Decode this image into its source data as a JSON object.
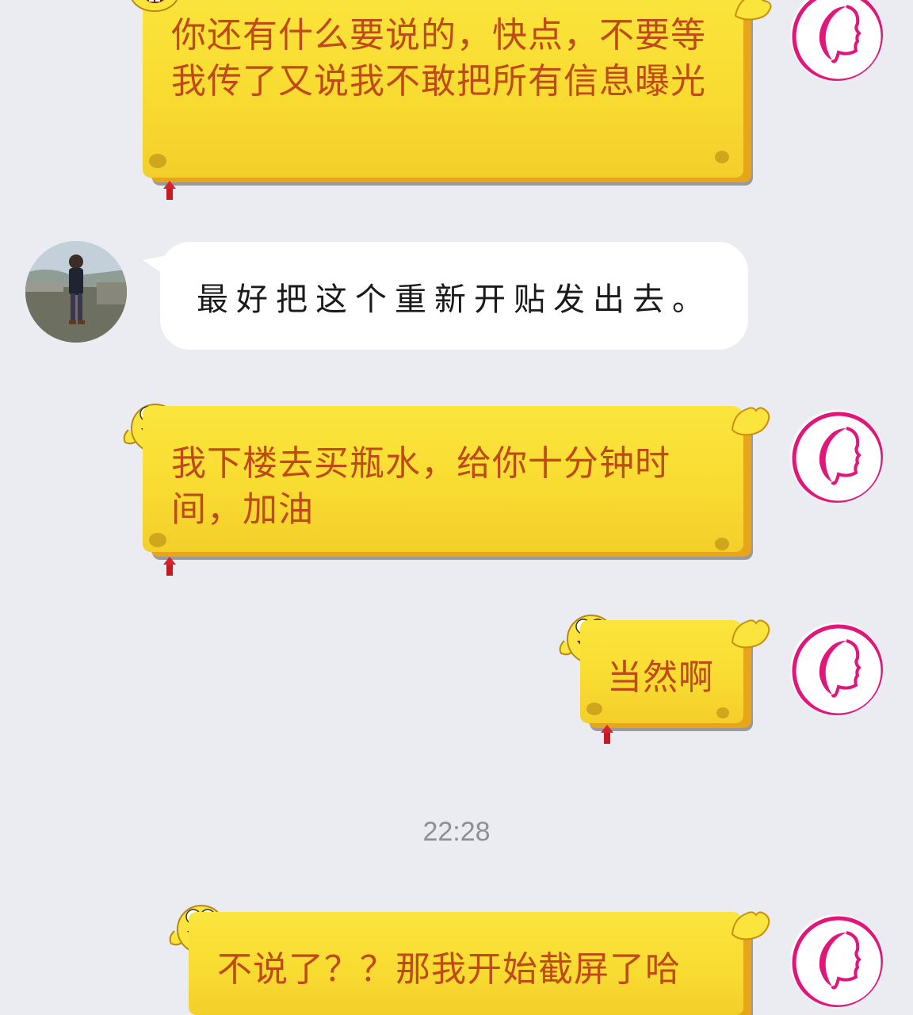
{
  "messages": [
    {
      "id": "m1",
      "sender": "self",
      "text": "你还有什么要说的，快点，不要等我传了又说我不敢把所有信息曝光"
    },
    {
      "id": "m2",
      "sender": "other",
      "text": "最好把这个重新开贴发出去。"
    },
    {
      "id": "m3",
      "sender": "self",
      "text": "我下楼去买瓶水，给你十分钟时间，加油"
    },
    {
      "id": "m4",
      "sender": "self",
      "text": "当然啊"
    },
    {
      "id": "ts1",
      "type": "timestamp",
      "text": "22:28"
    },
    {
      "id": "m5",
      "sender": "self",
      "text": "不说了？？那我开始截屏了哈"
    }
  ],
  "icons": {
    "self_avatar": "pink-woman-profile-logo-icon",
    "other_avatar": "man-standing-photo-avatar",
    "bubble_decoration": "spongebob-icon"
  },
  "colors": {
    "background": "#ebecf1",
    "bubble_yellow": "#f9dc32",
    "bubble_text": "#c04a16",
    "logo_pink": "#e2157a"
  }
}
